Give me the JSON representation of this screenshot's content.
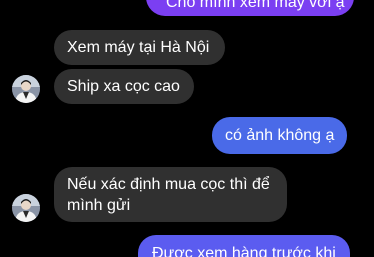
{
  "colors": {
    "background": "#000000",
    "incoming_bubble": "#303030",
    "outgoing_top": "#7b3ff2",
    "outgoing_mid": "#4a6ae8",
    "outgoing_bottom": "#5b5cf0",
    "text": "#ffffff"
  },
  "messages": [
    {
      "from": "me",
      "text": "Cho mình xem máy với ạ"
    },
    {
      "from": "them",
      "text": "Xem máy tại Hà Nội"
    },
    {
      "from": "them",
      "text": "Ship xa cọc cao"
    },
    {
      "from": "me",
      "text": "có ảnh không ạ"
    },
    {
      "from": "them",
      "text_line1": "Nếu xác định mua cọc thì để",
      "text_line2": "mình gửi"
    },
    {
      "from": "me",
      "text": "Được xem hàng trước khi"
    }
  ],
  "avatar_icon": "user-avatar"
}
